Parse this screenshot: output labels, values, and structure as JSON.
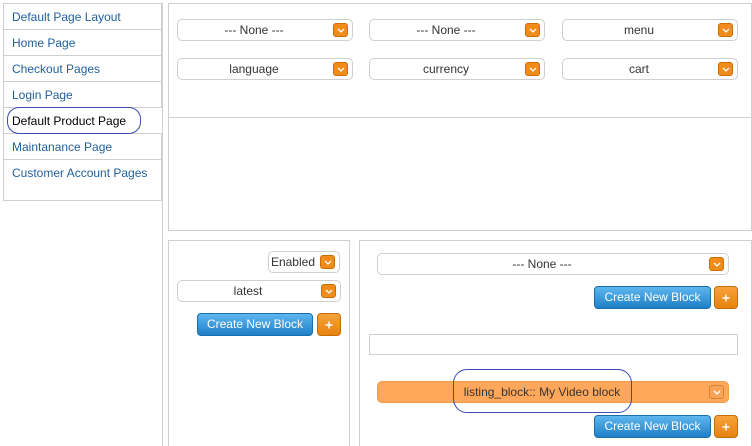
{
  "sidebar": {
    "items": [
      {
        "label": "Default Page Layout"
      },
      {
        "label": "Home Page"
      },
      {
        "label": "Checkout Pages"
      },
      {
        "label": "Login Page"
      },
      {
        "label": "Default Product Page"
      },
      {
        "label": "Maintanance Page"
      },
      {
        "label": "Customer Account Pages"
      }
    ]
  },
  "header_blocks": {
    "row1": [
      "--- None ---",
      "--- None ---",
      "menu"
    ],
    "row2": [
      "language",
      "currency",
      "cart"
    ]
  },
  "left_column": {
    "status": "Enabled",
    "block": "latest",
    "create_label": "Create New Block"
  },
  "main_column": {
    "top_block": "--- None ---",
    "create_label": "Create New Block",
    "input_value": "",
    "selected_block": "listing_block:: My Video block",
    "create_label_bottom": "Create New Block"
  },
  "colors": {
    "accent": "#f08c1a",
    "link": "#1f5f9c",
    "button_blue": "#1f7fc8",
    "highlight_ring": "#3b4bb3",
    "selected_row": "#ffa85c"
  },
  "icons": {
    "dropdown": "chevron-down-icon",
    "add": "plus-icon"
  }
}
